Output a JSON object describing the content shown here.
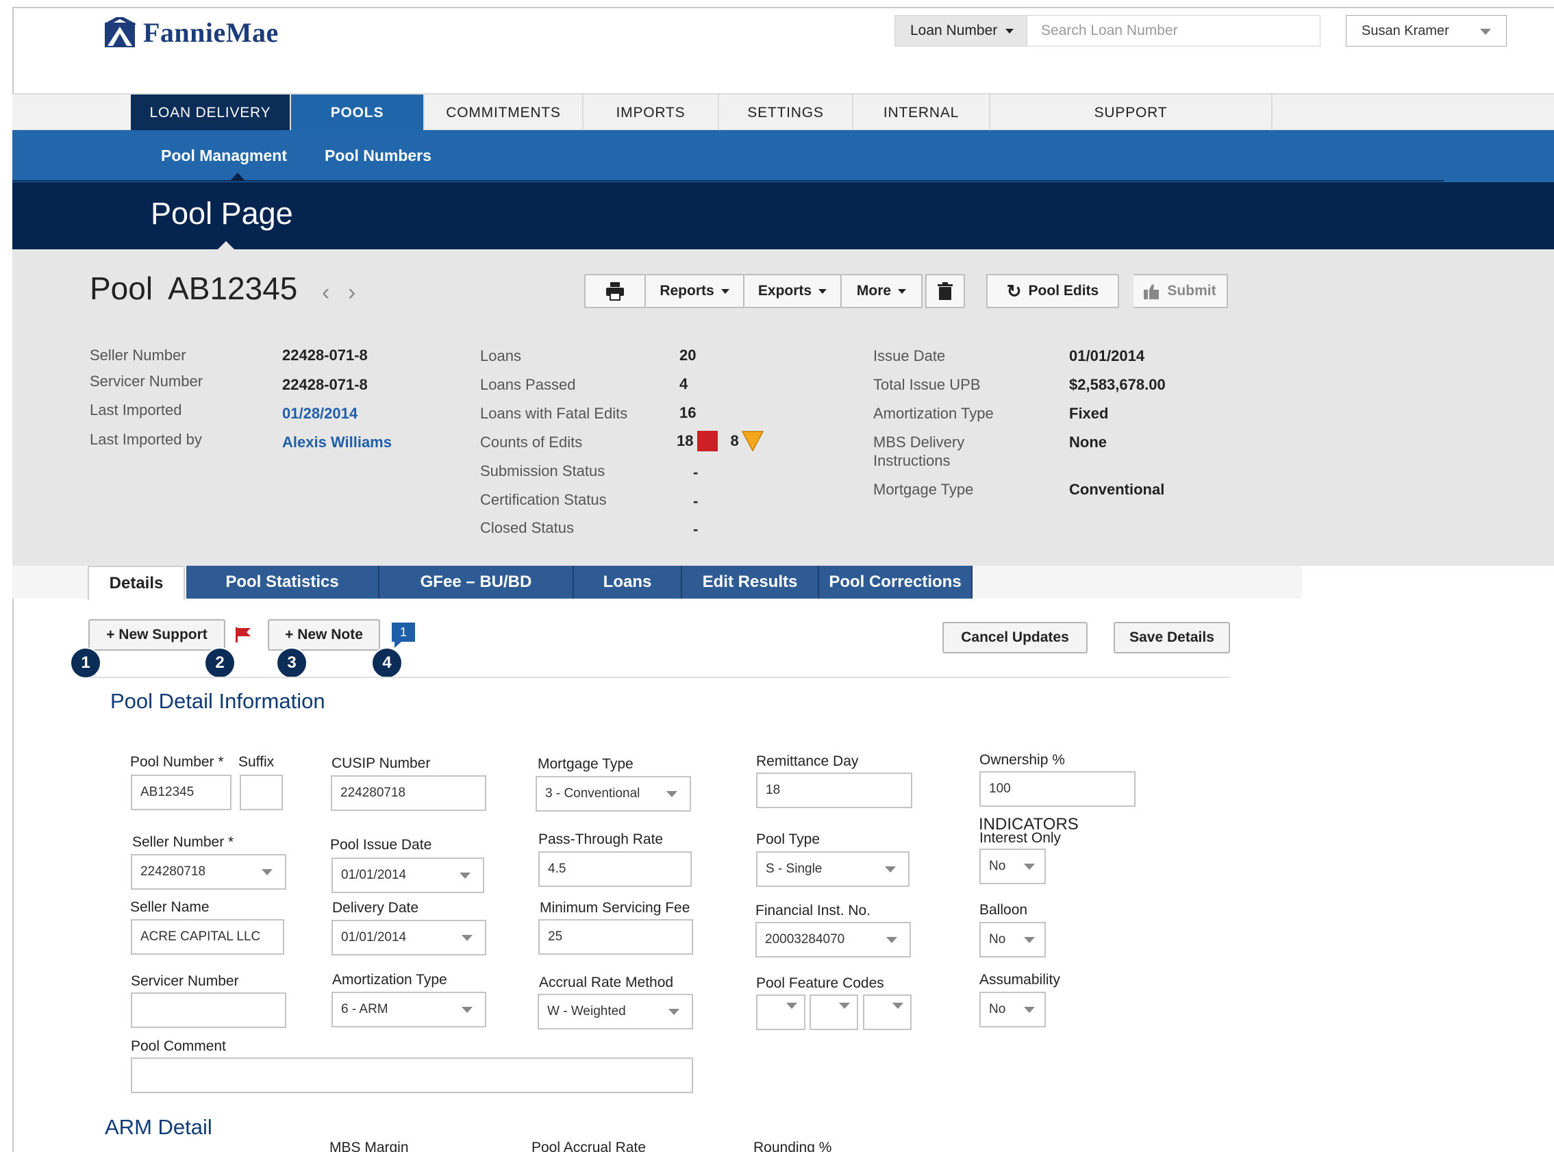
{
  "brand": {
    "name": "FannieMae"
  },
  "search": {
    "type_label": "Loan Number",
    "placeholder": "Search Loan Number"
  },
  "user": {
    "name": "Susan Kramer"
  },
  "main_nav": [
    "LOAN DELIVERY",
    "POOLS",
    "COMMITMENTS",
    "IMPORTS",
    "SETTINGS",
    "INTERNAL",
    "SUPPORT"
  ],
  "sub_nav": [
    "Pool Managment",
    "Pool Numbers"
  ],
  "page_title": "Pool Page",
  "pool": {
    "label": "Pool",
    "number": "AB12345"
  },
  "toolbar": {
    "reports": "Reports",
    "exports": "Exports",
    "more": "More",
    "pool_edits": "Pool Edits",
    "submit": "Submit"
  },
  "summary": {
    "col1": [
      {
        "label": "Seller Number",
        "value": "22428-071-8"
      },
      {
        "label": "Servicer Number",
        "value": "22428-071-8"
      },
      {
        "label": "Last Imported",
        "value": "01/28/2014"
      },
      {
        "label": "Last Imported by",
        "value": "Alexis Williams"
      }
    ],
    "col2": [
      {
        "label": "Loans",
        "value": "20"
      },
      {
        "label": "Loans Passed",
        "value": "4"
      },
      {
        "label": "Loans with Fatal Edits",
        "value": "16"
      },
      {
        "label": "Counts of Edits",
        "fatal": "18",
        "warning": "8"
      },
      {
        "label": "Submission Status",
        "value": "-"
      },
      {
        "label": "Certification Status",
        "value": "-"
      },
      {
        "label": "Closed Status",
        "value": "-"
      }
    ],
    "col3": [
      {
        "label": "Issue Date",
        "value": "01/01/2014"
      },
      {
        "label": "Total Issue UPB",
        "value": "$2,583,678.00"
      },
      {
        "label": "Amortization Type",
        "value": "Fixed"
      },
      {
        "label": "MBS Delivery",
        "label2": "Instructions",
        "value": "None"
      },
      {
        "label": "Mortgage Type",
        "value": "Conventional"
      }
    ]
  },
  "tabs": [
    "Details",
    "Pool Statistics",
    "GFee – BU/BD",
    "Loans",
    "Edit Results",
    "Pool Corrections"
  ],
  "actions": {
    "new_support": "+ New Support",
    "new_note": "+ New Note",
    "note_count": "1",
    "cancel": "Cancel Updates",
    "save": "Save Details",
    "badges": [
      "1",
      "2",
      "3",
      "4"
    ]
  },
  "section_title": "Pool Detail Information",
  "form": {
    "pool_number": {
      "label": "Pool Number *",
      "value": "AB12345"
    },
    "suffix": {
      "label": "Suffix",
      "value": ""
    },
    "cusip": {
      "label": "CUSIP Number",
      "value": "224280718"
    },
    "mortgage_type": {
      "label": "Mortgage Type",
      "value": "3 - Conventional"
    },
    "remittance_day": {
      "label": "Remittance Day",
      "value": "18"
    },
    "ownership": {
      "label": "Ownership %",
      "value": "100"
    },
    "seller_number": {
      "label": "Seller Number *",
      "value": "224280718"
    },
    "pool_issue_date": {
      "label": "Pool Issue Date",
      "value": "01/01/2014"
    },
    "pass_through_rate": {
      "label": "Pass-Through Rate",
      "value": "4.5"
    },
    "pool_type": {
      "label": "Pool Type",
      "value": "S - Single"
    },
    "indicators": "INDICATORS",
    "interest_only": {
      "label": "Interest Only",
      "value": "No"
    },
    "seller_name": {
      "label": "Seller Name",
      "value": "ACRE CAPITAL LLC"
    },
    "delivery_date": {
      "label": "Delivery Date",
      "value": "01/01/2014"
    },
    "min_servicing_fee": {
      "label": "Minimum Servicing Fee",
      "value": "25"
    },
    "financial_inst": {
      "label": "Financial Inst. No.",
      "value": "20003284070"
    },
    "balloon": {
      "label": "Balloon",
      "value": "No"
    },
    "servicer_number": {
      "label": "Servicer Number",
      "value": ""
    },
    "amortization_type": {
      "label": "Amortization Type",
      "value": "6 - ARM"
    },
    "accrual_rate_method": {
      "label": "Accrual Rate Method",
      "value": "W - Weighted"
    },
    "pool_feature_codes": {
      "label": "Pool Feature Codes"
    },
    "assumability": {
      "label": "Assumability",
      "value": "No"
    },
    "pool_comment": {
      "label": "Pool Comment",
      "value": ""
    }
  },
  "arm": {
    "title": "ARM Detail",
    "mbs_margin": "MBS Margin",
    "pool_accrual_rate": "Pool Accrual Rate",
    "rounding": "Rounding %"
  },
  "colors": {
    "nav_dark": "#0c2d57",
    "nav_blue": "#1f65aa",
    "subnav": "#2266ac",
    "header": "#062450",
    "fatal": "#cc2027",
    "warning": "#f4a71d"
  }
}
